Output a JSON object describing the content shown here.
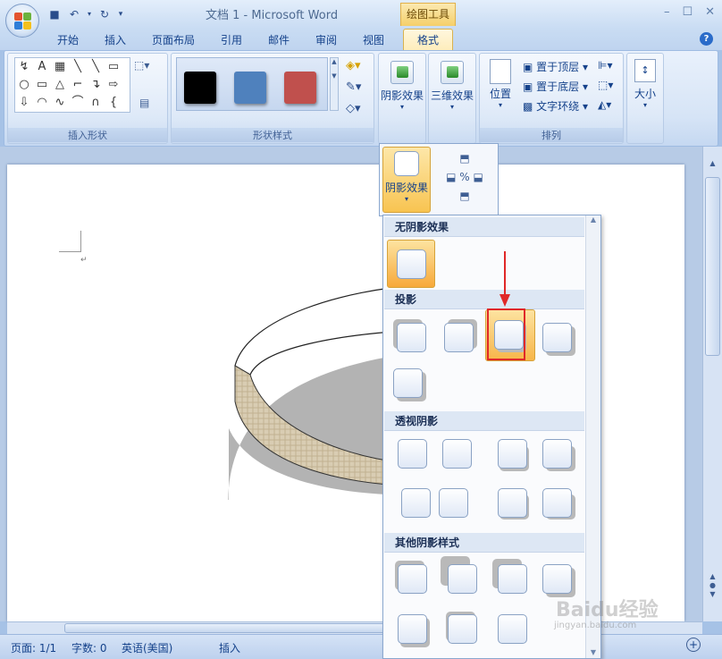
{
  "window": {
    "title": "文档 1 - Microsoft Word",
    "context_tab_group": "绘图工具",
    "controls": [
      "–",
      "☐",
      "✕"
    ]
  },
  "tabs": [
    "开始",
    "插入",
    "页面布局",
    "引用",
    "邮件",
    "审阅",
    "视图",
    "格式"
  ],
  "ribbon": {
    "insert_shapes_label": "插入形状",
    "shape_styles_label": "形状样式",
    "arrange_label": "排列",
    "shadow_effects_label": "阴影效果",
    "three_d_label": "三维效果",
    "position_label": "位置",
    "bring_to_front": "置于顶层",
    "send_to_back": "置于底层",
    "text_wrap": "文字环绕",
    "size_label": "大小",
    "shape_glyphs": [
      "↯",
      "A",
      "▦",
      "╲",
      "╲",
      "▭",
      "○",
      "▭",
      "△",
      "⌐",
      "↴",
      "⇨",
      "⇩",
      "◠",
      "∿",
      "⌒",
      "∩",
      "{"
    ],
    "style_colors": [
      "#000000",
      "#4f81bd",
      "#c0504d"
    ]
  },
  "popup": {
    "shadow_effects_label": "阴影效果"
  },
  "gallery": {
    "no_shadow": "无阴影效果",
    "drop_shadow": "投影",
    "perspective_shadow": "透视阴影",
    "other_shadow": "其他阴影样式"
  },
  "status": {
    "page": "页面: 1/1",
    "words": "字数: 0",
    "language": "英语(美国)",
    "mode": "插入"
  },
  "watermark": "Baidu经验",
  "watermark_sub": "jingyan.baidu.com",
  "accent": "#e02828"
}
